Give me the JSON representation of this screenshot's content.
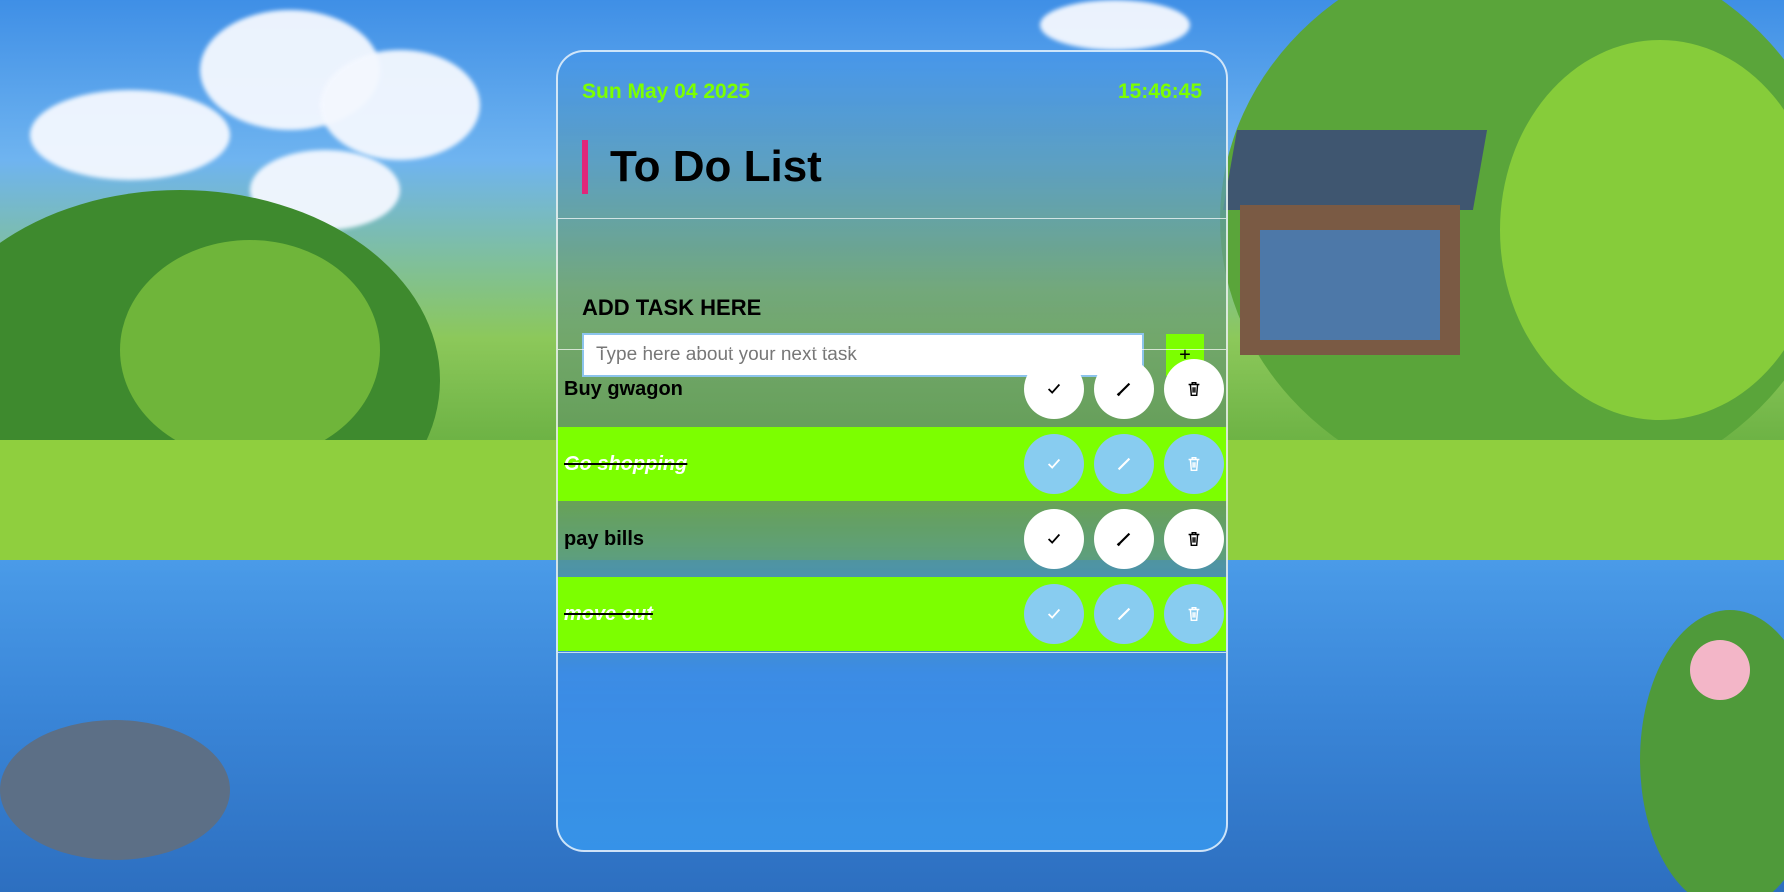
{
  "header": {
    "date": "Sun May 04 2025",
    "time": "15:46:45",
    "title": "To Do List"
  },
  "add_task": {
    "label": "ADD TASK HERE",
    "placeholder": "Type here about your next task",
    "value": "",
    "button_label": "+"
  },
  "tasks": [
    {
      "text": "Buy gwagon",
      "completed": false
    },
    {
      "text": "Go shopping",
      "completed": true
    },
    {
      "text": "pay bills",
      "completed": false
    },
    {
      "text": "move out",
      "completed": true
    }
  ],
  "icons": {
    "complete": "check-icon",
    "edit": "pencil-icon",
    "delete": "trash-icon"
  },
  "colors": {
    "accent_green": "#7cff00",
    "title_accent": "#e0277a",
    "completed_button": "#88ccf0"
  }
}
